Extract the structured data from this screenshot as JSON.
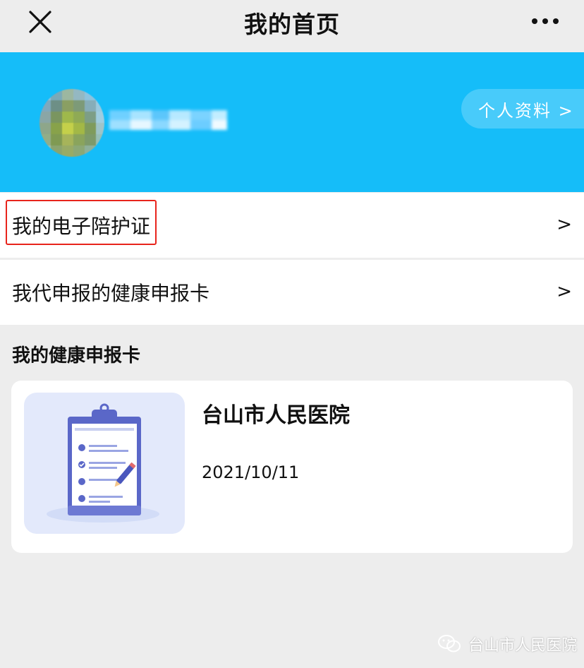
{
  "nav": {
    "title": "我的首页",
    "close_icon": "close-icon",
    "more_icon": "more-icon"
  },
  "profile": {
    "avatar_icon": "avatar",
    "profile_link_label": "个人资料 >",
    "banner_color": "#15bdf9"
  },
  "menu": {
    "items": [
      {
        "label": "我的电子陪护证",
        "chevron": ">"
      },
      {
        "label": "我代申报的健康申报卡",
        "chevron": ">"
      }
    ],
    "highlight_color": "#e8241c"
  },
  "section": {
    "title": "我的健康申报卡"
  },
  "card": {
    "hospital": "台山市人民医院",
    "date": "2021/10/11",
    "thumbnail_icon": "clipboard-icon"
  },
  "watermark": {
    "text": "台山市人民医院",
    "icon": "wechat-icon"
  }
}
